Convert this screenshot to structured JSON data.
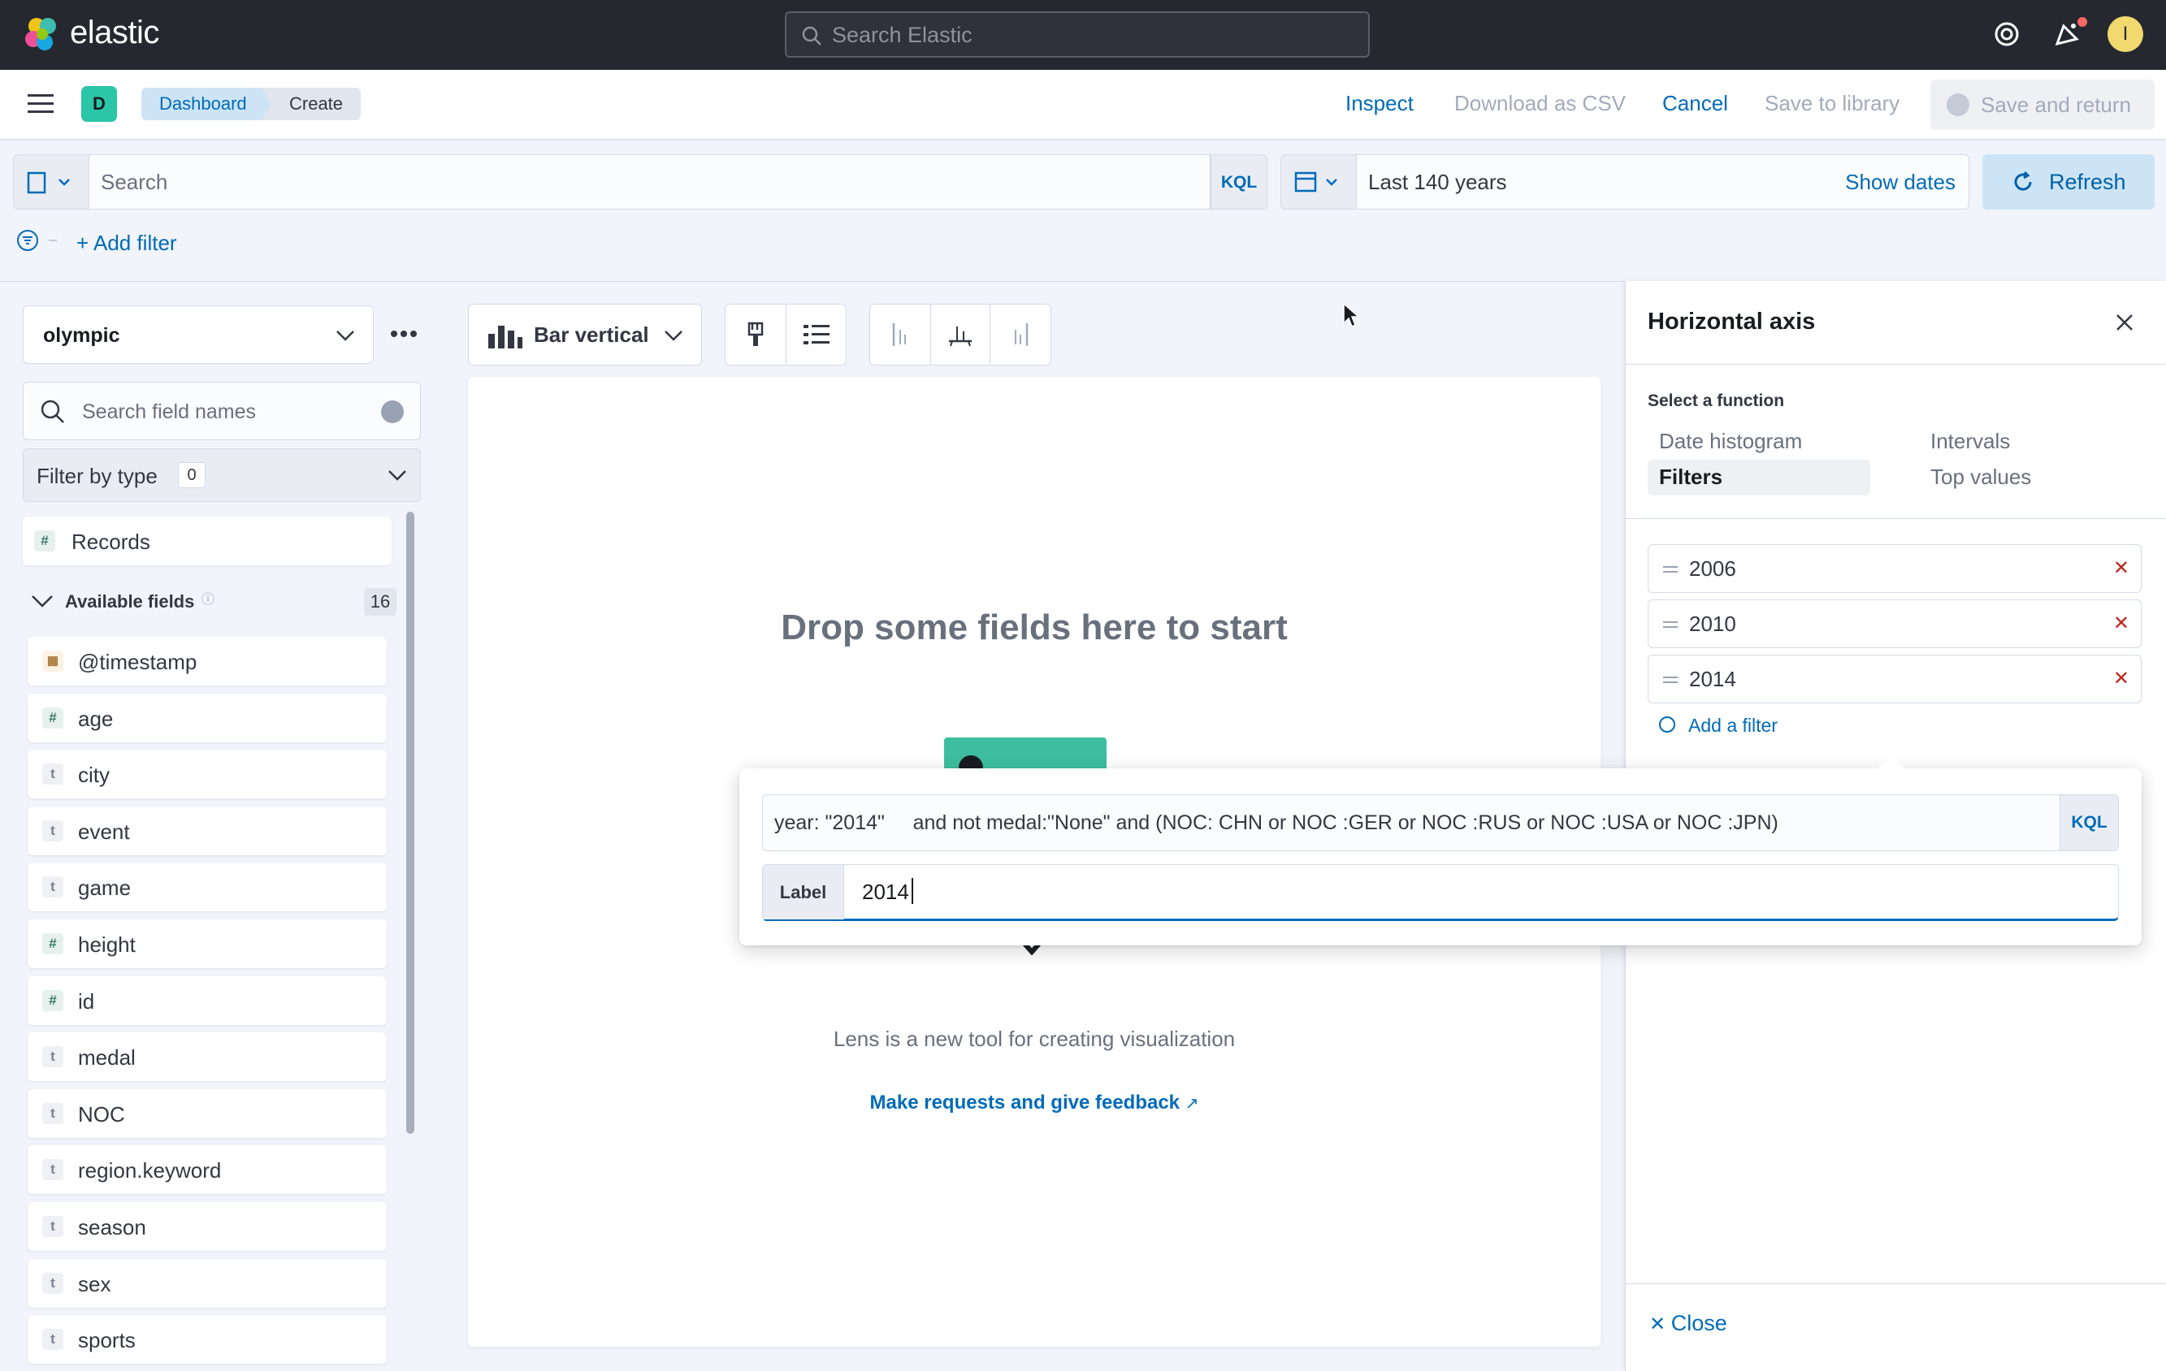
{
  "topbar": {
    "brand": "elastic",
    "search_placeholder": "Search Elastic",
    "user_initial": "I"
  },
  "header": {
    "space_initial": "D",
    "breadcrumbs": [
      "Dashboard",
      "Create"
    ],
    "inspect": "Inspect",
    "download_csv": "Download as CSV",
    "cancel": "Cancel",
    "save_to_library": "Save to library",
    "save_and_return": "Save and return"
  },
  "querybar": {
    "search_placeholder": "Search",
    "kql": "KQL",
    "date_range": "Last 140 years",
    "show_dates": "Show dates",
    "refresh": "Refresh",
    "add_filter": "+ Add filter"
  },
  "left_panel": {
    "index_pattern": "olympic",
    "field_search_placeholder": "Search field names",
    "filter_by_type": "Filter by type",
    "filter_count": "0",
    "records": "Records",
    "available_fields_label": "Available fields",
    "available_fields_count": "16",
    "fields": [
      {
        "name": "@timestamp",
        "type": "date"
      },
      {
        "name": "age",
        "type": "number"
      },
      {
        "name": "city",
        "type": "string"
      },
      {
        "name": "event",
        "type": "string"
      },
      {
        "name": "game",
        "type": "string"
      },
      {
        "name": "height",
        "type": "number"
      },
      {
        "name": "id",
        "type": "number"
      },
      {
        "name": "medal",
        "type": "string"
      },
      {
        "name": "NOC",
        "type": "string"
      },
      {
        "name": "region.keyword",
        "type": "string"
      },
      {
        "name": "season",
        "type": "string"
      },
      {
        "name": "sex",
        "type": "string"
      },
      {
        "name": "sports",
        "type": "string"
      }
    ]
  },
  "workspace": {
    "viz_type": "Bar vertical",
    "drop_title": "Drop some fields here to start",
    "lens_description": "Lens is a new tool for creating visualization",
    "feedback_link": "Make requests and give feedback"
  },
  "flyout": {
    "title": "Horizontal axis",
    "select_function_label": "Select a function",
    "functions": [
      "Date histogram",
      "Intervals",
      "Filters",
      "Top values"
    ],
    "selected_function": "Filters",
    "filters": [
      "2006",
      "2010",
      "2014"
    ],
    "add_filter": "Add a filter",
    "close": "Close"
  },
  "popover": {
    "query": "year: \"2014\"     and not medal:\"None\" and (NOC: CHN or NOC :GER or NOC :RUS or NOC :USA or NOC :JPN)",
    "kql": "KQL",
    "label_prepend": "Label",
    "label_value": "2014"
  },
  "colors": {
    "topbar": "#25282f",
    "link": "#006bb8",
    "accent_green": "#3dbea0",
    "danger": "#bd271e"
  }
}
